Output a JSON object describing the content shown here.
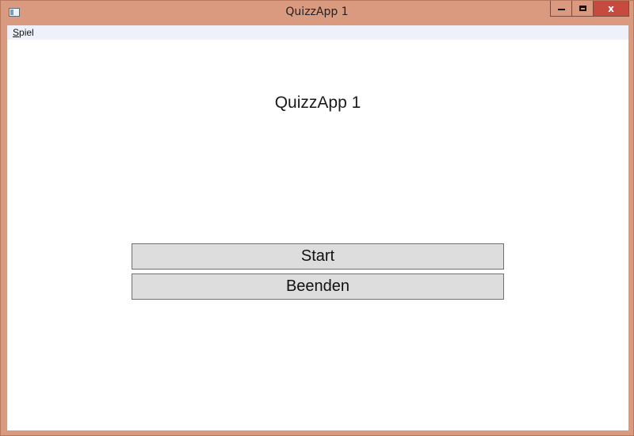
{
  "window": {
    "title": "QuizzApp 1",
    "close_glyph": "x",
    "icons": {
      "app": "application-icon",
      "minimize": "minimize-icon",
      "maximize": "maximize-icon",
      "close": "close-icon"
    },
    "colors": {
      "frame": "#d99a80",
      "close": "#c74a3e",
      "menubar": "#eef1f9",
      "button": "#dddddd"
    }
  },
  "menu": {
    "items": [
      {
        "accel": "S",
        "rest": "piel"
      }
    ]
  },
  "main": {
    "heading": "QuizzApp 1",
    "start_label": "Start",
    "quit_label": "Beenden"
  }
}
